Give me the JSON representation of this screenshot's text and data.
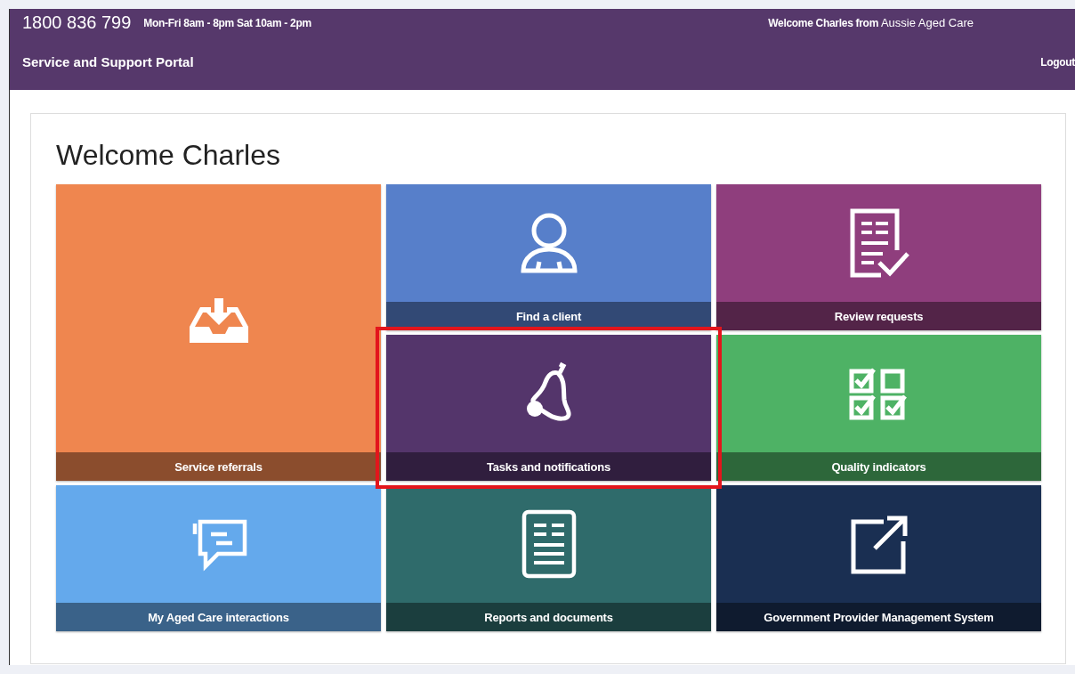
{
  "header": {
    "phone": "1800 836 799",
    "hours": "Mon-Fri 8am - 8pm Sat 10am - 2pm",
    "welcome": "**Welcome Charles from** Aussie Aged Care",
    "portal_title": "Service and Support Portal",
    "logout": "Logout"
  },
  "heading": "Welcome Charles",
  "tiles": [
    {
      "label": "Find a client",
      "color": "#577fca",
      "highlighted": false
    },
    {
      "label": "Review requests",
      "color": "#8f3e7d",
      "highlighted": false
    },
    {
      "label": "Service referrals",
      "color": "#ef864f",
      "highlighted": false
    },
    {
      "label": "Tasks and notifications",
      "color": "#54356b",
      "highlighted": true
    },
    {
      "label": "Quality indicators",
      "color": "#4eb265",
      "highlighted": false
    },
    {
      "label": "My Aged Care interactions",
      "color": "#64a9ec",
      "highlighted": false
    },
    {
      "label": "Reports and documents",
      "color": "#2f6b6b",
      "highlighted": false
    },
    {
      "label": "Government Provider Management System",
      "color": "#1a2f52",
      "highlighted": false
    }
  ]
}
